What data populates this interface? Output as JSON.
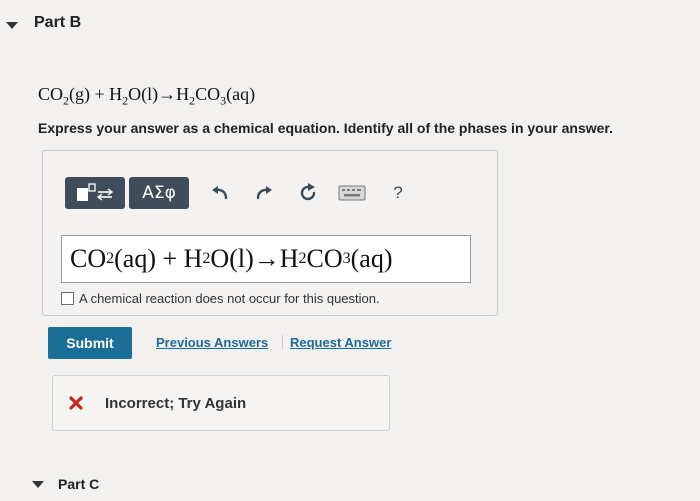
{
  "part_b": {
    "title": "Part B",
    "reaction": {
      "co": "CO",
      "co_sub": "2",
      "co_phase": "(g) + H",
      "h_sub": "2",
      "water": "O(l)→H",
      "h2_sub": "2",
      "carb": "CO",
      "carb_sub": "3",
      "carb_phase": "(aq)"
    },
    "instruction": "Express your answer as a chemical equation. Identify all of the phases in your answer."
  },
  "toolbar": {
    "templates_icon": "templates-icon",
    "greek_label": "ΑΣφ",
    "undo_icon": "undo-icon",
    "redo_icon": "redo-icon",
    "reset_icon": "reset-icon",
    "keyboard_icon": "keyboard-icon",
    "help_label": "?"
  },
  "answer": {
    "p1": "CO",
    "s1": "2",
    "p2": " (aq) + H",
    "s2": "2",
    "p3": " O(l)→H",
    "s3": "2",
    "p4": " CO",
    "s4": "3",
    "p5": " (aq)"
  },
  "no_reaction_label": "A chemical reaction does not occur for this question.",
  "actions": {
    "submit": "Submit",
    "previous_answers": "Previous Answers",
    "request_answer": "Request Answer"
  },
  "feedback": {
    "icon": "x-icon",
    "text": "Incorrect; Try Again",
    "color": "#c8261b"
  },
  "part_c": {
    "title": "Part C"
  }
}
